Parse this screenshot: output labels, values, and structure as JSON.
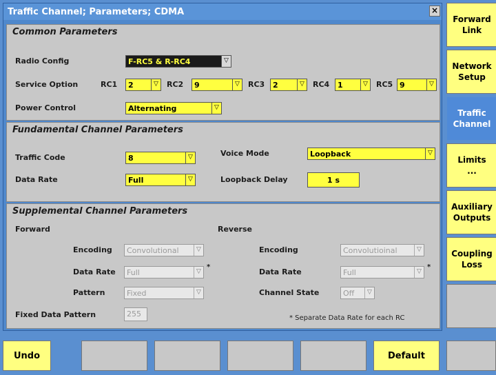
{
  "dialog": {
    "title": "Traffic Channel; Parameters; CDMA",
    "close_label": "×"
  },
  "common": {
    "title": "Common Parameters",
    "radio_config_label": "Radio Config",
    "radio_config_value": "F-RC5 & R-RC4",
    "service_option_label": "Service Option",
    "rc": [
      {
        "label": "RC1",
        "value": "2"
      },
      {
        "label": "RC2",
        "value": "9"
      },
      {
        "label": "RC3",
        "value": "2"
      },
      {
        "label": "RC4",
        "value": "1"
      },
      {
        "label": "RC5",
        "value": "9"
      }
    ],
    "power_control_label": "Power Control",
    "power_control_value": "Alternating"
  },
  "fundamental": {
    "title": "Fundamental Channel Parameters",
    "traffic_code_label": "Traffic Code",
    "traffic_code_value": "8",
    "data_rate_label": "Data Rate",
    "data_rate_value": "Full",
    "voice_mode_label": "Voice Mode",
    "voice_mode_value": "Loopback",
    "loopback_delay_label": "Loopback Delay",
    "loopback_delay_value": "1 s"
  },
  "supplemental": {
    "title": "Supplemental Channel Parameters",
    "forward_label": "Forward",
    "reverse_label": "Reverse",
    "fwd_encoding_label": "Encoding",
    "fwd_encoding_value": "Convolutional",
    "fwd_data_rate_label": "Data Rate",
    "fwd_data_rate_value": "Full",
    "fwd_pattern_label": "Pattern",
    "fwd_pattern_value": "Fixed",
    "fixed_data_pattern_label": "Fixed Data Pattern",
    "fixed_data_pattern_value": "255",
    "rev_encoding_label": "Encoding",
    "rev_encoding_value": "Convolutioinal",
    "rev_data_rate_label": "Data Rate",
    "rev_data_rate_value": "Full",
    "channel_state_label": "Channel State",
    "channel_state_value": "Off",
    "star": "*",
    "note": "* Separate Data Rate for each RC"
  },
  "side_buttons": [
    {
      "line1": "Forward",
      "line2": "Link"
    },
    {
      "line1": "Network",
      "line2": "Setup"
    },
    {
      "line1": "Traffic",
      "line2": "Channel"
    },
    {
      "line1": "Limits",
      "line2": "..."
    },
    {
      "line1": "Auxiliary",
      "line2": "Outputs"
    },
    {
      "line1": "Coupling",
      "line2": "Loss"
    }
  ],
  "bottom_buttons": {
    "undo": "Undo",
    "default": "Default"
  },
  "icons": {
    "dropdown": "▽"
  }
}
